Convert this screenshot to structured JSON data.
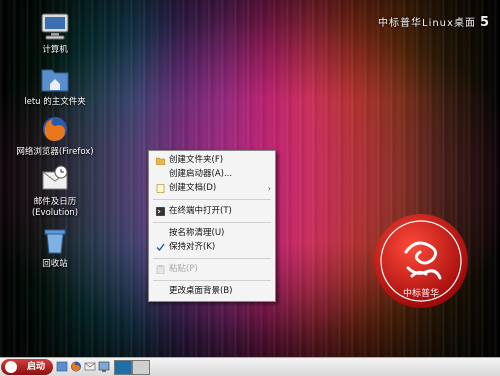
{
  "desktop": {
    "brand_text": "中标普华Linux桌面",
    "brand_version": "5",
    "icons": [
      {
        "label": "计算机",
        "icon": "computer-icon"
      },
      {
        "label": "letu 的主文件夹",
        "icon": "home-folder-icon"
      },
      {
        "label": "网络浏览器(Firefox)",
        "icon": "firefox-icon"
      },
      {
        "label": "邮件及日历",
        "label2": "(Evolution)",
        "icon": "evolution-mail-icon"
      },
      {
        "label": "回收站",
        "icon": "trash-icon"
      }
    ],
    "seal_text": "中标普华"
  },
  "context_menu": {
    "items": [
      {
        "label": "创建文件夹(F)",
        "icon": "new-folder-icon"
      },
      {
        "label": "创建启动器(A)...",
        "icon": ""
      },
      {
        "label": "创建文档(D)",
        "icon": "new-document-icon",
        "submenu": "›"
      },
      {
        "label": "在终端中打开(T)",
        "icon": "terminal-icon"
      },
      {
        "label": "按名称清理(U)",
        "icon": ""
      },
      {
        "label": "保持对齐(K)",
        "icon": "checkmark-icon",
        "checked": true
      },
      {
        "label": "粘贴(P)",
        "icon": "paste-icon",
        "disabled": true
      },
      {
        "label": "更改桌面背景(B)",
        "icon": ""
      }
    ]
  },
  "panel": {
    "start_label": "启动",
    "launchers": [
      "file-manager-icon",
      "firefox-launcher-icon",
      "mail-launcher-icon",
      "show-desktop-icon"
    ],
    "workspaces": [
      "workspace-1",
      "workspace-2"
    ]
  },
  "colors": {
    "menu_bg": "#f4f4f4",
    "start_red": "#c52020",
    "seal_red": "#d81818",
    "workspace_active": "#1e6fa8"
  }
}
